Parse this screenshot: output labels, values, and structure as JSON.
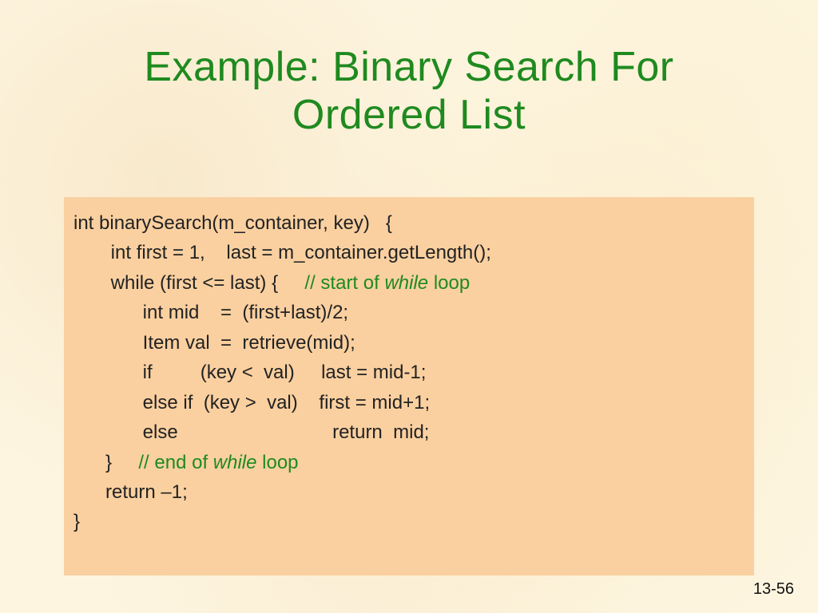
{
  "title_line1": "Example: Binary Search For",
  "title_line2": "Ordered List",
  "code": {
    "l1": "int binarySearch(m_container, key)   {",
    "l2": "       int first = 1,    last = m_container.getLength();",
    "l3a": "       while (first <= last) {     ",
    "l3b": "// start of ",
    "l3c": "while",
    "l3d": " loop",
    "l4": "             int mid    =  (first+last)/2;",
    "l5": "             Item val  =  retrieve(mid);",
    "l6": "             if         (key <  val)     last = mid-1;",
    "l7": "             else if  (key >  val)    first = mid+1;",
    "l8": "             else                             return  mid;",
    "l9a": "      }     ",
    "l9b": "// end of ",
    "l9c": "while",
    "l9d": " loop",
    "l10": "      return –1;",
    "l11": "}"
  },
  "pagenum": "13-56"
}
